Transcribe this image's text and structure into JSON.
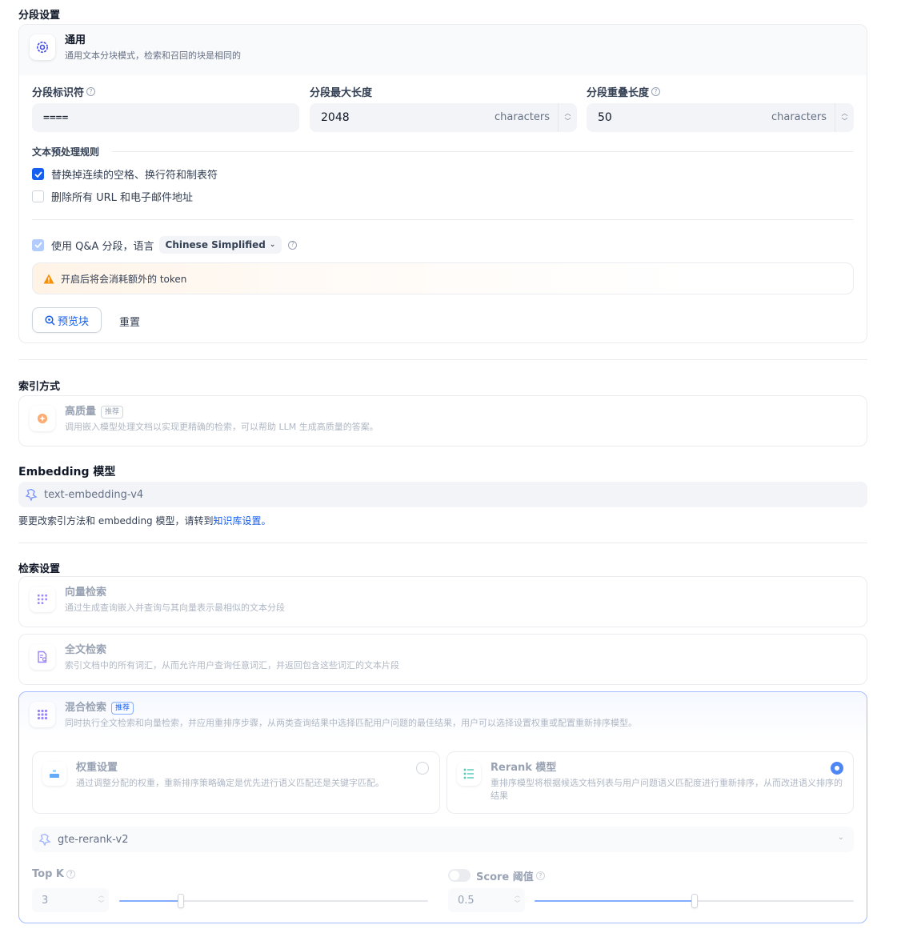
{
  "segment": {
    "section_title": "分段设置",
    "general": {
      "title": "通用",
      "desc": "通用文本分块模式，检索和召回的块是相同的"
    },
    "separator": {
      "label": "分段标识符",
      "value": "===="
    },
    "max_length": {
      "label": "分段最大长度",
      "value": "2048",
      "unit": "characters"
    },
    "overlap": {
      "label": "分段重叠长度",
      "value": "50",
      "unit": "characters"
    },
    "preprocess": {
      "title": "文本预处理规则",
      "rules": [
        {
          "label": "替换掉连续的空格、换行符和制表符",
          "checked": true
        },
        {
          "label": "删除所有 URL 和电子邮件地址",
          "checked": false
        }
      ]
    },
    "qa": {
      "label": "使用 Q&A 分段，语言",
      "language": "Chinese Simplified",
      "checked": true
    },
    "warning": "开启后将会消耗额外的 token",
    "preview_button": "预览块",
    "reset_button": "重置"
  },
  "index": {
    "section_title": "索引方式",
    "high_quality": {
      "title": "高质量",
      "badge": "推荐",
      "desc": "调用嵌入模型处理文档以实现更精确的检索，可以帮助 LLM 生成高质量的答案。"
    }
  },
  "embedding": {
    "section_title": "Embedding 模型",
    "model": "text-embedding-v4",
    "note_prefix": "要更改索引方法和 embedding 模型，请转到",
    "note_link": "知识库设置。"
  },
  "retrieval": {
    "section_title": "检索设置",
    "vector": {
      "title": "向量检索",
      "desc": "通过生成查询嵌入并查询与其向量表示最相似的文本分段"
    },
    "fulltext": {
      "title": "全文检索",
      "desc": "索引文档中的所有词汇，从而允许用户查询任意词汇，并返回包含这些词汇的文本片段"
    },
    "hybrid": {
      "title": "混合检索",
      "badge": "推荐",
      "desc": "同时执行全文检索和向量检索，并应用重排序步骤，从两类查询结果中选择匹配用户问题的最佳结果，用户可以选择设置权重或配置重新排序模型。",
      "weight": {
        "title": "权重设置",
        "desc": "通过调整分配的权重，重新排序策略确定是优先进行语义匹配还是关键字匹配。",
        "selected": false
      },
      "rerank": {
        "title": "Rerank 模型",
        "desc": "重排序模型将根据候选文档列表与用户问题语义匹配度进行重新排序，从而改进语义排序的结果",
        "selected": true
      },
      "rerank_model": "gte-rerank-v2",
      "top_k": {
        "label": "Top K",
        "value": "3",
        "fraction": 0.2
      },
      "score": {
        "label": "Score 阈值",
        "value": "0.5",
        "fraction": 0.5,
        "enabled": false
      }
    }
  },
  "colors": {
    "accent": "#155eef",
    "warning_bg": "#fff6ed",
    "warning_icon": "#f79009"
  }
}
